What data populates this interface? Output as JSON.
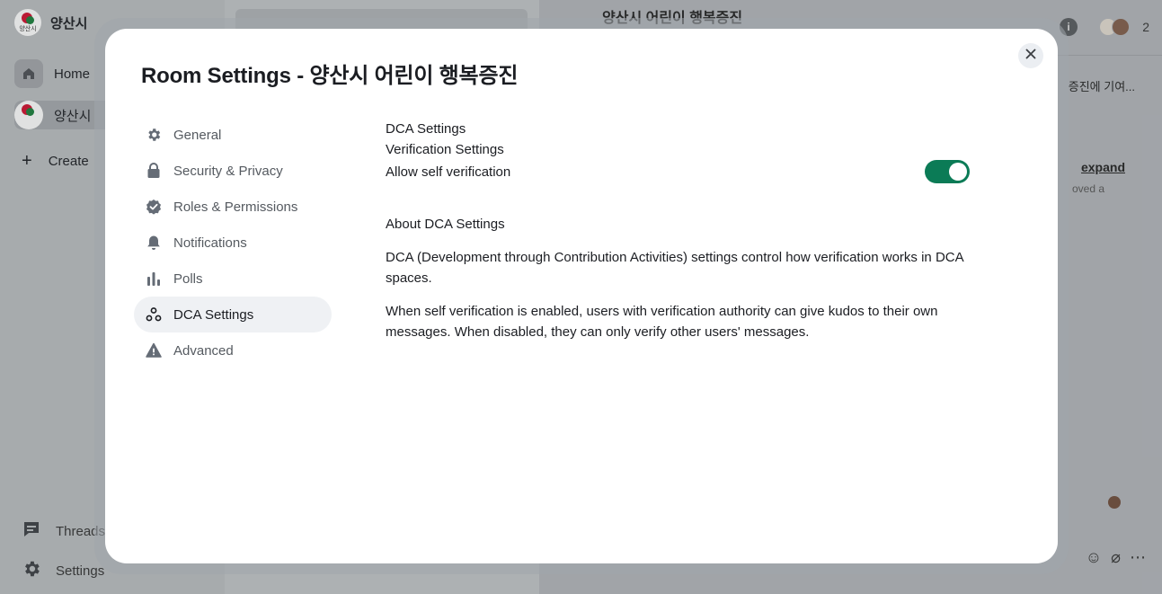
{
  "space_panel": {
    "space_name": "양산시",
    "logo_text": "양산시",
    "items": [
      {
        "label": "Home"
      },
      {
        "label": "양산시"
      },
      {
        "label": "Create"
      }
    ],
    "bottom_items": [
      {
        "label": "Threads"
      },
      {
        "label": "Settings"
      }
    ]
  },
  "chat": {
    "room_name": "양산시 어린이 행복증진",
    "member_count": "2",
    "topic_snippet": "증진에 기여...",
    "expand_label": "expand",
    "moved_text": "oved a"
  },
  "modal": {
    "title": "Room Settings - 양산시 어린이 행복증진",
    "nav": [
      {
        "label": "General",
        "icon": "gear-icon"
      },
      {
        "label": "Security & Privacy",
        "icon": "lock-icon"
      },
      {
        "label": "Roles & Permissions",
        "icon": "shield-check-icon"
      },
      {
        "label": "Notifications",
        "icon": "bell-icon"
      },
      {
        "label": "Polls",
        "icon": "bar-chart-icon"
      },
      {
        "label": "DCA Settings",
        "icon": "people-icon",
        "selected": true
      },
      {
        "label": "Advanced",
        "icon": "warning-icon"
      }
    ],
    "content": {
      "heading": "DCA Settings",
      "subheading": "Verification Settings",
      "toggle_label": "Allow self verification",
      "toggle_on": true,
      "about_heading": "About DCA Settings",
      "paragraph1": "DCA (Development through Contribution Activities) settings control how verification works in DCA spaces.",
      "paragraph2": "When self verification is enabled, users with verification authority can give kudos to their own messages. When disabled, they can only verify other users' messages."
    }
  },
  "colors": {
    "toggle_on": "#0b7b56",
    "nav_selected_bg": "#eff1f4"
  }
}
